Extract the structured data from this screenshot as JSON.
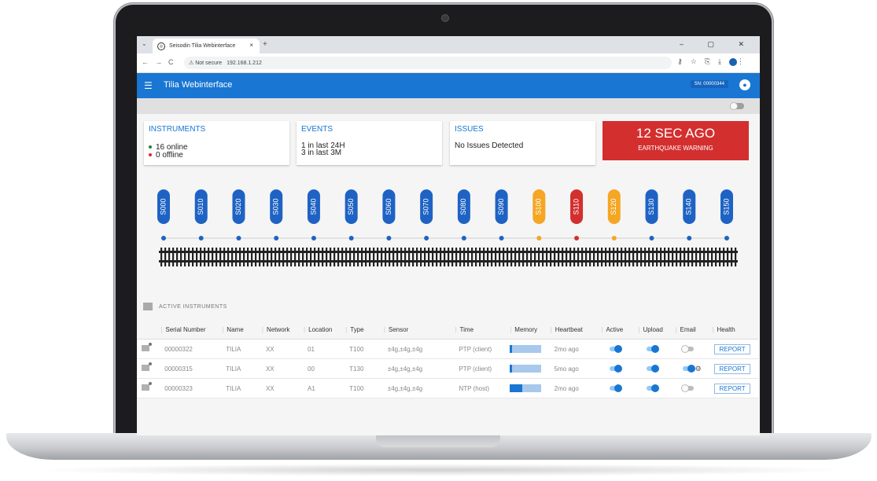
{
  "browser": {
    "tab_title": "Seisodin Tilia Webinterface",
    "tab_close": "×",
    "new_tab": "+",
    "security": "Not secure",
    "url": "192.168.1.212",
    "window_controls": "– ▢ ✕"
  },
  "app": {
    "title": "Tilia Webinterface",
    "serial": "SN: 00000344",
    "menu_icon": "menu-icon",
    "user_icon": "account-icon"
  },
  "cards": {
    "instruments": {
      "title": "INSTRUMENTS",
      "online": "16 online",
      "offline": "0 offline"
    },
    "events": {
      "title": "EVENTS",
      "line1": "1 in last 24H",
      "line2": "3 in last 3M"
    },
    "issues": {
      "title": "ISSUES",
      "text": "No Issues Detected"
    },
    "alarm": {
      "time": "12 SEC AGO",
      "label": "EARTHQUAKE WARNING"
    }
  },
  "colors": {
    "ok": "#1e63c4",
    "warn": "#f5a623",
    "alarm": "#d32f2f",
    "appbar": "#1976d2"
  },
  "stations": [
    {
      "id": "S000",
      "status": "ok"
    },
    {
      "id": "S010",
      "status": "ok"
    },
    {
      "id": "S020",
      "status": "ok"
    },
    {
      "id": "S030",
      "status": "ok"
    },
    {
      "id": "S040",
      "status": "ok"
    },
    {
      "id": "S050",
      "status": "ok"
    },
    {
      "id": "S060",
      "status": "ok"
    },
    {
      "id": "S070",
      "status": "ok"
    },
    {
      "id": "S080",
      "status": "ok"
    },
    {
      "id": "S090",
      "status": "ok"
    },
    {
      "id": "S100",
      "status": "warn"
    },
    {
      "id": "S110",
      "status": "alarm"
    },
    {
      "id": "S120",
      "status": "warn"
    },
    {
      "id": "S130",
      "status": "ok"
    },
    {
      "id": "S140",
      "status": "ok"
    },
    {
      "id": "S150",
      "status": "ok"
    }
  ],
  "active": {
    "title": "ACTIVE INSTRUMENTS",
    "columns": [
      "Serial Number",
      "Name",
      "Network",
      "Location",
      "Type",
      "Sensor",
      "Time",
      "Memory",
      "Heartbeat",
      "Active",
      "Upload",
      "Email",
      "Health"
    ],
    "rows": [
      {
        "serial": "00000322",
        "name": "TILIA",
        "network": "XX",
        "location": "01",
        "type": "T100",
        "sensor": "±4g,±4g,±4g",
        "time": "PTP (client)",
        "memory": 0.08,
        "heartbeat": "2mo ago",
        "active": true,
        "upload": true,
        "email": false,
        "health": "REPORT"
      },
      {
        "serial": "00000315",
        "name": "TILIA",
        "network": "XX",
        "location": "00",
        "type": "T130",
        "sensor": "±4g,±4g,±4g",
        "time": "PTP (client)",
        "memory": 0.08,
        "heartbeat": "5mo ago",
        "active": true,
        "upload": true,
        "email": true,
        "health": "REPORT"
      },
      {
        "serial": "00000323",
        "name": "TILIA",
        "network": "XX",
        "location": "A1",
        "type": "T100",
        "sensor": "±4g,±4g,±4g",
        "time": "NTP (host)",
        "memory": 0.4,
        "heartbeat": "2mo ago",
        "active": true,
        "upload": true,
        "email": false,
        "health": "REPORT"
      }
    ]
  }
}
